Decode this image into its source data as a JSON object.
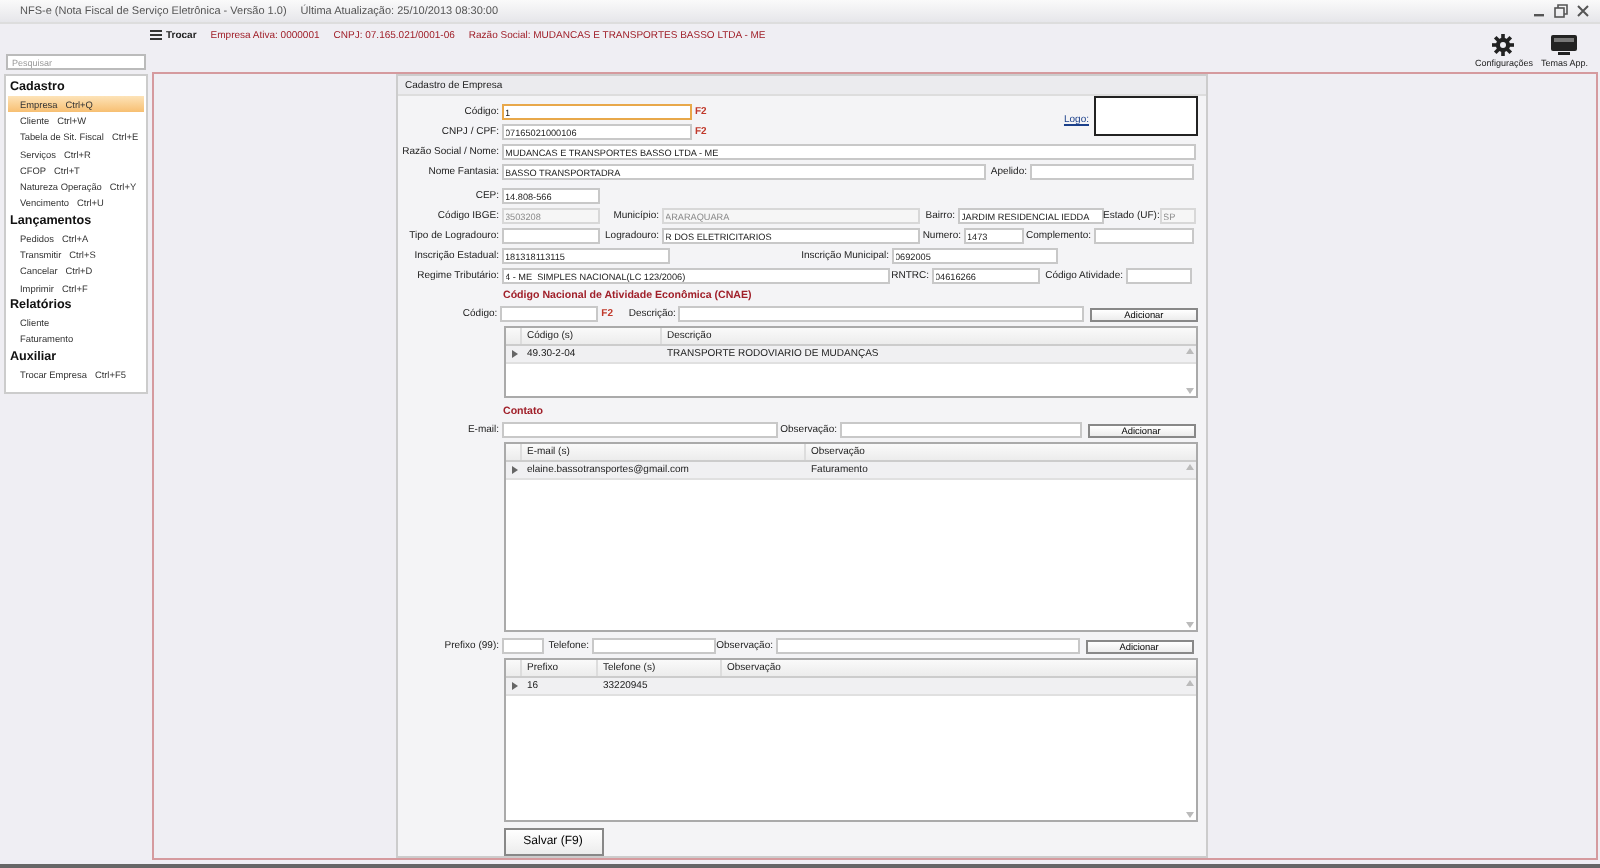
{
  "window": {
    "title": "NFS-e (Nota Fiscal de Serviço Eletrônica - Versão 1.0)",
    "last_update": "Última Atualização: 25/10/2013 08:30:00"
  },
  "header": {
    "switch_button": "Trocar",
    "company": "Empresa Ativa: 0000001",
    "cnpj": "CNPJ: 07.165.021/0001-06",
    "name": "Razão Social: MUDANCAS E TRANSPORTES BASSO LTDA - ME"
  },
  "toolbar": [
    {
      "label": "Configurações",
      "kind": "gear"
    },
    {
      "label": "Temas App.",
      "kind": "monitor"
    }
  ],
  "sidebar": {
    "search": {
      "placeholder": "Pesquisar"
    },
    "groups": [
      {
        "title": "Cadastro",
        "items": [
          {
            "label": "Empresa",
            "shortcut": "Ctrl+Q",
            "selected": true
          },
          {
            "label": "Cliente",
            "shortcut": "Ctrl+W",
            "selected": false
          },
          {
            "label": "Tabela de Sit. Fiscal",
            "shortcut": "Ctrl+E",
            "selected": false
          },
          {
            "label": "Serviços",
            "shortcut": "Ctrl+R",
            "selected": false
          },
          {
            "label": "CFOP",
            "shortcut": "Ctrl+T",
            "selected": false
          },
          {
            "label": "Natureza Operação",
            "shortcut": "Ctrl+Y",
            "selected": false
          },
          {
            "label": "Vencimento",
            "shortcut": "Ctrl+U",
            "selected": false
          }
        ]
      },
      {
        "title": "Lançamentos",
        "items": [
          {
            "label": "Pedidos",
            "shortcut": "Ctrl+A",
            "selected": false
          },
          {
            "label": "Transmitir",
            "shortcut": "Ctrl+S",
            "selected": false
          },
          {
            "label": "Cancelar",
            "shortcut": "Ctrl+D",
            "selected": false
          },
          {
            "label": "Imprimir",
            "shortcut": "Ctrl+F",
            "selected": false
          }
        ]
      },
      {
        "title": "Relatórios",
        "items": [
          {
            "label": "Cliente",
            "selected": false
          },
          {
            "label": "Faturamento",
            "selected": false
          }
        ]
      },
      {
        "title": "Auxiliar",
        "items": [
          {
            "label": "Trocar Empresa",
            "shortcut": "Ctrl+F5",
            "selected": false
          }
        ]
      }
    ]
  },
  "form": {
    "title": "Cadastro de Empresa",
    "logo_link": "Logo:",
    "lines": [
      {
        "fields": [
          {
            "label": "Código:",
            "value": "1",
            "hint": "F2",
            "focused": true,
            "disabled": false
          }
        ]
      },
      {
        "fields": [
          {
            "label": "CNPJ / CPF:",
            "value": "07165021000106",
            "hint": "F2",
            "focused": false,
            "disabled": false
          }
        ]
      },
      {
        "fields": [
          {
            "label": "Razão Social / Nome:",
            "value": "MUDANCAS E TRANSPORTES BASSO LTDA - ME",
            "focused": false,
            "disabled": false
          }
        ]
      },
      {
        "fields": [
          {
            "label": "Nome Fantasia:",
            "value": "BASSO TRANSPORTADRA",
            "focused": false,
            "disabled": false
          },
          {
            "label": "Apelido:",
            "focused": false,
            "disabled": false
          }
        ]
      },
      {
        "fields": [
          {
            "label": "CEP:",
            "value": "14.808-566",
            "focused": false,
            "disabled": false
          }
        ]
      },
      {
        "fields": [
          {
            "label": "Código IBGE:",
            "value": "3503208",
            "focused": false,
            "disabled": true
          },
          {
            "label": "Município:",
            "value": "ARARAQUARA",
            "focused": false,
            "disabled": true
          },
          {
            "label": "Bairro:",
            "value": "JARDIM RESIDENCIAL IEDDA",
            "focused": false,
            "disabled": false
          },
          {
            "label": "Estado (UF):",
            "value": "SP",
            "focused": false,
            "disabled": true
          }
        ]
      },
      {
        "fields": [
          {
            "label": "Tipo de Logradouro:",
            "focused": false,
            "disabled": false
          },
          {
            "label": "Logradouro:",
            "value": "R DOS ELETRICITARIOS",
            "focused": false,
            "disabled": false
          },
          {
            "label": "Numero:",
            "value": "1473",
            "focused": false,
            "disabled": false
          },
          {
            "label": "Complemento:",
            "focused": false,
            "disabled": false
          }
        ]
      },
      {
        "fields": [
          {
            "label": "Inscrição Estadual:",
            "value": "181318113115",
            "focused": false,
            "disabled": false
          },
          {
            "label": "Inscrição Municipal:",
            "value": "0692005",
            "focused": false,
            "disabled": false
          }
        ]
      },
      {
        "fields": [
          {
            "label": "Regime Tributário:",
            "value": "4 - ME  SIMPLES NACIONAL(LC 123/2006)",
            "focused": false,
            "disabled": false
          },
          {
            "label": "RNTRC:",
            "value": "04616266",
            "focused": false,
            "disabled": false
          },
          {
            "label": "Código Atividade:",
            "focused": false,
            "disabled": false
          }
        ]
      }
    ],
    "sections": [
      {
        "title": "Código Nacional de Atividade Econômica (CNAE)",
        "inputs": [
          {
            "label": "Código:",
            "hint": "F2"
          },
          {
            "label": "Descrição:"
          }
        ],
        "button": "Adicionar",
        "grid": {
          "columns": [
            "Código (s)",
            "Descrição"
          ],
          "rows": [
            [
              "49.30-2-04",
              "TRANSPORTE RODOVIARIO DE MUDANÇAS"
            ]
          ]
        }
      },
      {
        "title": "Contato",
        "inputs": [
          {
            "label": "E-mail:"
          },
          {
            "label": "Observação:"
          }
        ],
        "button": "Adicionar",
        "grid": {
          "columns": [
            "E-mail (s)",
            "Observação"
          ],
          "rows": [
            [
              "elaine.bassotransportes@gmail.com",
              "Faturamento"
            ]
          ]
        }
      },
      {
        "inputs": [
          {
            "label": "Prefixo (99):"
          },
          {
            "label": "Telefone:"
          },
          {
            "label": "Observação:"
          }
        ],
        "button": "Adicionar",
        "grid": {
          "columns": [
            "Prefixo",
            "Telefone (s)",
            "Observação"
          ],
          "rows": [
            [
              "16",
              "33220945"
            ]
          ]
        }
      }
    ],
    "save_button": "Salvar (F9)"
  }
}
